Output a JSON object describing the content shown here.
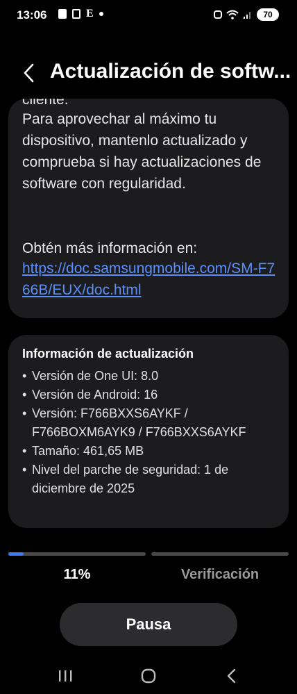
{
  "status_bar": {
    "time": "13:06",
    "icon_glyph": "E",
    "battery": "70",
    "icons": [
      "nfc-icon",
      "screenshot-icon",
      "e-icon",
      "notification-dot-icon",
      "alarm-icon",
      "wifi-icon",
      "signal-icon",
      "battery-icon"
    ]
  },
  "header": {
    "title": "Actualización de softw..."
  },
  "description": {
    "partial_line": "cliente.",
    "text": "Para aprovechar al máximo tu dispositivo, mantenlo actualizado y comprueba si hay actualizaciones de software con regularidad.",
    "info_label": "Obtén más información en:",
    "link": "https://doc.samsungmobile.com/SM-F766B/EUX/doc.html"
  },
  "update_info": {
    "title": "Información de actualización",
    "items": [
      "Versión de One UI: 8.0",
      "Versión de Android: 16",
      "Versión: F766BXXS6AYKF / F766BOXM6AYK9 / F766BXXS6AYKF",
      "Tamaño: 461,65 MB",
      "Nivel del parche de seguridad: 1 de diciembre de 2025"
    ]
  },
  "progress": {
    "percent_label": "11%",
    "fill_fraction": 0.11,
    "stage_label": "Verificación"
  },
  "actions": {
    "pause_label": "Pausa"
  },
  "colors": {
    "background": "#000000",
    "card": "#1c1c1e",
    "accent": "#3e7bf6",
    "link": "#5b8ff9",
    "muted": "#9a9a9a"
  }
}
